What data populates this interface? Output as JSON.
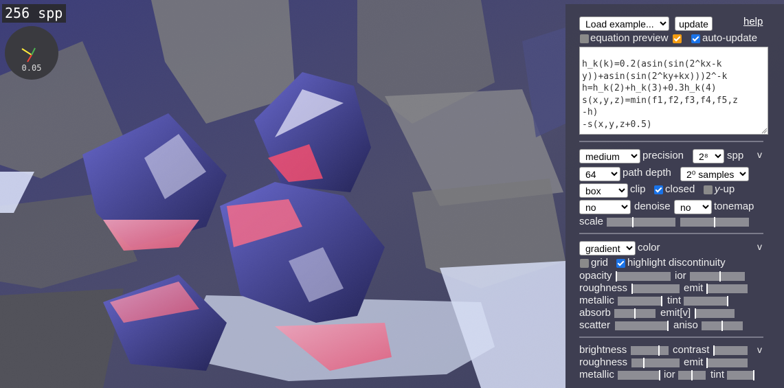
{
  "render": {
    "spp_label": "256 spp",
    "axes_value": "0.05"
  },
  "panel": {
    "example_select": "Load example...",
    "update_button": "update",
    "help_link": "help",
    "equation_preview": "equation preview",
    "auto_update": "auto-update",
    "equation_text": "h_k(k)=0.2(asin(sin(2^kx-k\ny))+asin(sin(2^ky+kx)))2^-k\nh=h_k(2)+h_k(3)+0.3h_k(4)\ns(x,y,z)=min(f1,f2,f3,f4,f5,z\n-h)\n-s(x,y,z+0.5)",
    "render_settings": {
      "precision_select": "medium",
      "precision_label": "precision",
      "spp_select": "2⁸",
      "spp_label": "spp",
      "collapse": "v",
      "path_depth_select": "64",
      "path_depth_label": "path depth",
      "samples_select": "2⁰ samples",
      "clip_select": "box",
      "clip_label": "clip",
      "closed_label": "closed",
      "yup_y": "y",
      "yup_rest": "-up",
      "denoise_select": "no",
      "denoise_label": "denoise",
      "tonemap_select": "no",
      "tonemap_label": "tonemap",
      "scale_label": "scale",
      "scale_slider_1": 0.38,
      "scale_slider_2": 0.5
    },
    "material": {
      "color_select": "gradient",
      "color_label": "color",
      "collapse": "v",
      "grid_label": "grid",
      "highlight_label": "highlight discontinuity",
      "opacity_label": "opacity",
      "ior_label": "ior",
      "roughness_label": "roughness",
      "emit_label": "emit",
      "metallic_label": "metallic",
      "tint_label": "tint",
      "absorb_label": "absorb",
      "emitv_label": "emit[v]",
      "scatter_label": "scatter",
      "aniso_label": "aniso",
      "opacity": 0.0,
      "ior": 0.55,
      "roughness": 0.0,
      "emit": 0.0,
      "metallic": 1.0,
      "tint": 1.0,
      "absorb": 0.5,
      "emitv": 0.0,
      "scatter": 1.0,
      "aniso": 0.5
    },
    "lighting": {
      "brightness_label": "brightness",
      "contrast_label": "contrast",
      "collapse": "v",
      "roughness_label": "roughness",
      "emit_label": "emit",
      "metallic_label": "metallic",
      "ior_label": "ior",
      "tint_label": "tint",
      "brightness": 0.75,
      "contrast": 0.0,
      "roughness": 0.25,
      "emit": 0.0,
      "metallic": 1.0,
      "ior": 0.5,
      "tint": 1.0
    }
  },
  "colors": {
    "panel_bg": "#3e3e50",
    "checkbox_checked": "#1a73e8",
    "checkbox_orange": "#f39c12",
    "background_scene": "#2a2c4a"
  }
}
